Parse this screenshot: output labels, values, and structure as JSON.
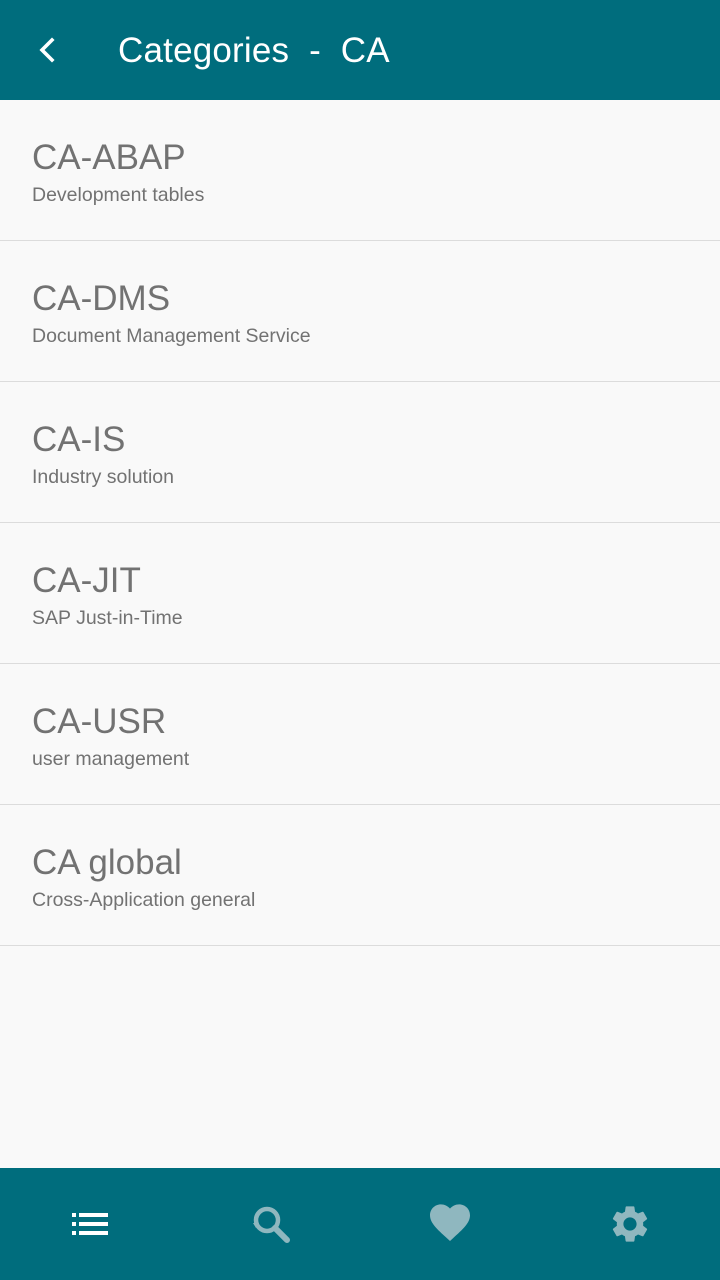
{
  "header": {
    "title": "Categories  -  CA",
    "back_icon": "chevron-left-icon"
  },
  "colors": {
    "primary": "#006d7d",
    "background": "#f9f9f9",
    "text_secondary": "#727272",
    "divider": "#dcdcdc",
    "nav_icon_active": "#ffffff",
    "nav_icon_inactive": "#8fb7bf"
  },
  "items": [
    {
      "code": "CA-ABAP",
      "description": "Development tables"
    },
    {
      "code": "CA-DMS",
      "description": "Document Management Service"
    },
    {
      "code": "CA-IS",
      "description": "Industry solution"
    },
    {
      "code": "CA-JIT",
      "description": "SAP Just-in-Time"
    },
    {
      "code": "CA-USR",
      "description": "user management"
    },
    {
      "code": "CA global",
      "description": "Cross-Application general"
    }
  ],
  "bottom_nav": {
    "active": "list",
    "items": [
      {
        "id": "list",
        "icon": "list-icon"
      },
      {
        "id": "search",
        "icon": "search-icon"
      },
      {
        "id": "favorites",
        "icon": "heart-icon"
      },
      {
        "id": "settings",
        "icon": "gear-icon"
      }
    ]
  }
}
